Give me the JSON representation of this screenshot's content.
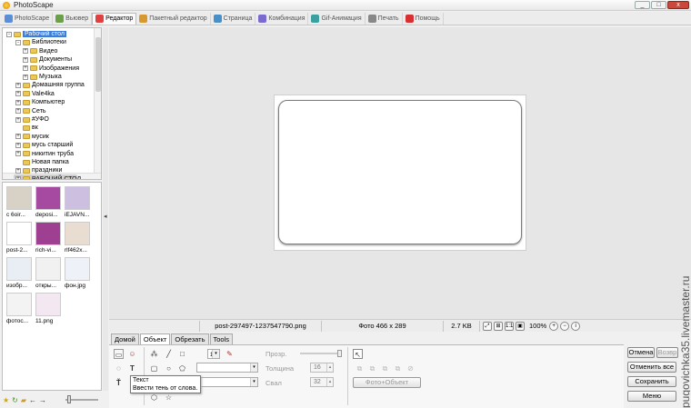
{
  "window": {
    "title": "PhotoScape",
    "min": "_",
    "max": "□",
    "close": "x"
  },
  "tabs": [
    {
      "label": "PhotoScape",
      "color": "#5a8ed8"
    },
    {
      "label": "Вьювер",
      "color": "#6aa04a"
    },
    {
      "label": "Редактор",
      "color": "#e04040"
    },
    {
      "label": "Пакетный редактор",
      "color": "#d89830"
    },
    {
      "label": "Страница",
      "color": "#4a90c8"
    },
    {
      "label": "Комбинация",
      "color": "#7a6ad0"
    },
    {
      "label": "Gif-Анимация",
      "color": "#3aa0a0"
    },
    {
      "label": "Печать",
      "color": "#888888"
    },
    {
      "label": "Помощь",
      "color": "#d83030"
    }
  ],
  "tree": [
    {
      "label": "Рабочий стол",
      "exp": "-",
      "selected": true
    },
    {
      "label": "Библиотеки",
      "exp": "-"
    },
    {
      "label": "Видео",
      "exp": "+"
    },
    {
      "label": "Документы",
      "exp": "+"
    },
    {
      "label": "Изображения",
      "exp": "+"
    },
    {
      "label": "Музыка",
      "exp": "+"
    },
    {
      "label": "Домашняя группа",
      "exp": "+"
    },
    {
      "label": "Vale4ka",
      "exp": "+"
    },
    {
      "label": "Компьютер",
      "exp": "+"
    },
    {
      "label": "Сеть",
      "exp": "+"
    },
    {
      "label": "#УФО",
      "exp": "+"
    },
    {
      "label": "вк",
      "exp": ""
    },
    {
      "label": "мусик",
      "exp": "+"
    },
    {
      "label": "мусь старший",
      "exp": "+"
    },
    {
      "label": "никитин труба",
      "exp": "+"
    },
    {
      "label": "Новая папка",
      "exp": ""
    },
    {
      "label": "праздники",
      "exp": "+"
    },
    {
      "label": "РАБОЧИЙ СТОЛ",
      "exp": "+"
    }
  ],
  "thumbnails": [
    {
      "label": "с 6oir...",
      "fill": "#d8d2c6"
    },
    {
      "label": "deposi...",
      "fill": "#a54aa0"
    },
    {
      "label": "iEJAVN...",
      "fill": "#cdbfe0"
    },
    {
      "label": "post-2...",
      "fill": "#ffffff"
    },
    {
      "label": "rich-vi...",
      "fill": "#9e3f92"
    },
    {
      "label": "rlf462x...",
      "fill": "#e8ddd0"
    },
    {
      "label": "изобр...",
      "fill": "#e9eef5"
    },
    {
      "label": "откры...",
      "fill": "#f1f1f1"
    },
    {
      "label": "фон.jpg",
      "fill": "#eef2f8"
    },
    {
      "label": "фотос...",
      "fill": "#f3f3f3"
    },
    {
      "label": "11.png",
      "fill": "#f3e8f2"
    }
  ],
  "status": {
    "filename": "post-297497-1237547790.png",
    "dimensions": "Фото 466 x 289",
    "filesize": "2.7 KB",
    "zoom": "100%"
  },
  "panel_tabs": [
    "Домой",
    "Объект",
    "Обрезать",
    "Tools"
  ],
  "active_panel_tab": 1,
  "props": {
    "transparency_label": "Прозр.",
    "thickness_label": "Толщина",
    "thickness_value": "16",
    "round_label": "Свал",
    "round_value": "32",
    "photo_object_button": "Фото+Объект",
    "line_width_value": "1"
  },
  "tooltip": {
    "title": "Текст",
    "text": "Ввести тень от слова."
  },
  "right_buttons": {
    "undo": "Отмена",
    "redo": "Возвр",
    "undo_all": "Отменить все",
    "save": "Сохранить",
    "menu": "Меню"
  },
  "watermark": "pugovichka35.livemaster.ru"
}
